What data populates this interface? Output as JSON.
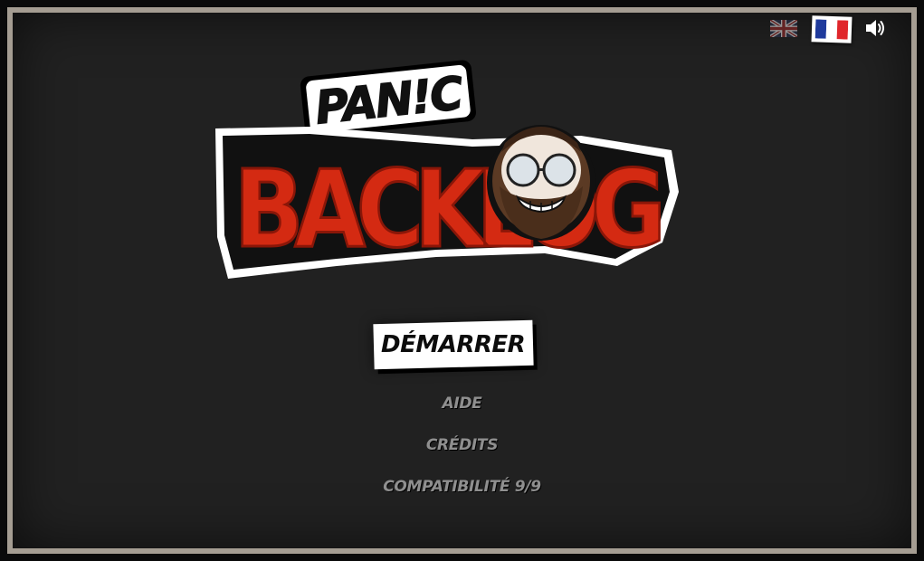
{
  "header": {
    "languages": [
      {
        "code": "en",
        "icon": "uk-flag-icon",
        "active": false
      },
      {
        "code": "fr",
        "icon": "fr-flag-icon",
        "active": true
      }
    ],
    "sound_icon": "speaker-icon"
  },
  "logo": {
    "line1": "PAN!C",
    "line2": "BACKLOG"
  },
  "menu": {
    "start_label": "DÉMARRER",
    "help_label": "AIDE",
    "credits_label": "CRÉDITS",
    "compat_label": "COMPATIBILITÉ 9/9"
  },
  "colors": {
    "frame_border": "#a59d92",
    "background": "#212121",
    "logo_red": "#d42a12",
    "menu_grey": "#8f8f8f"
  }
}
